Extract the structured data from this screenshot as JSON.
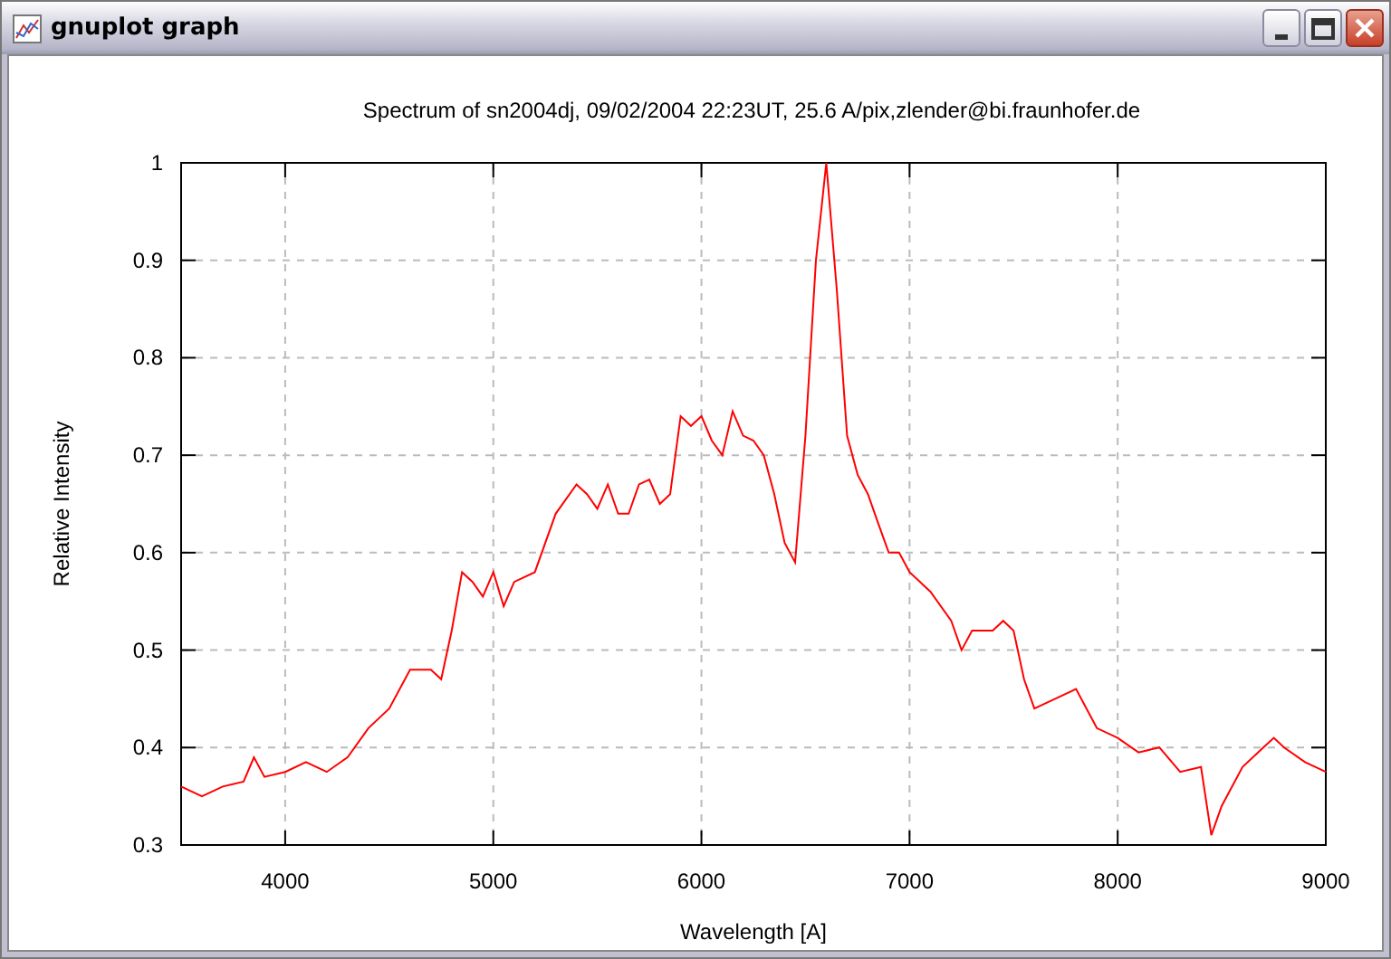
{
  "window": {
    "title": "gnuplot graph"
  },
  "chart_data": {
    "type": "line",
    "title": "Spectrum of sn2004dj, 09/02/2004 22:23UT, 25.6 A/pix,zlender@bi.fraunhofer.de",
    "xlabel": "Wavelength [A]",
    "ylabel": "Relative Intensity",
    "x": [
      3500,
      3600,
      3700,
      3800,
      3850,
      3900,
      4000,
      4100,
      4200,
      4300,
      4400,
      4500,
      4600,
      4700,
      4750,
      4800,
      4850,
      4900,
      4950,
      5000,
      5050,
      5100,
      5200,
      5300,
      5400,
      5450,
      5500,
      5550,
      5600,
      5650,
      5700,
      5750,
      5800,
      5850,
      5900,
      5950,
      6000,
      6050,
      6100,
      6150,
      6200,
      6250,
      6300,
      6350,
      6400,
      6450,
      6500,
      6550,
      6600,
      6650,
      6700,
      6750,
      6800,
      6850,
      6900,
      6950,
      7000,
      7100,
      7200,
      7250,
      7300,
      7400,
      7450,
      7500,
      7550,
      7600,
      7700,
      7800,
      7900,
      8000,
      8100,
      8200,
      8300,
      8400,
      8450,
      8500,
      8600,
      8700,
      8750,
      8800,
      8900,
      9000
    ],
    "grid": true,
    "series": [
      {
        "color": "#ff0000",
        "values": [
          0.36,
          0.35,
          0.36,
          0.365,
          0.39,
          0.37,
          0.375,
          0.385,
          0.375,
          0.39,
          0.42,
          0.44,
          0.48,
          0.48,
          0.47,
          0.52,
          0.58,
          0.57,
          0.555,
          0.58,
          0.545,
          0.57,
          0.58,
          0.64,
          0.67,
          0.66,
          0.645,
          0.67,
          0.64,
          0.64,
          0.67,
          0.675,
          0.65,
          0.66,
          0.74,
          0.73,
          0.74,
          0.715,
          0.7,
          0.745,
          0.72,
          0.715,
          0.7,
          0.66,
          0.61,
          0.59,
          0.72,
          0.9,
          1.0,
          0.87,
          0.72,
          0.68,
          0.66,
          0.63,
          0.6,
          0.6,
          0.58,
          0.56,
          0.53,
          0.5,
          0.52,
          0.52,
          0.53,
          0.52,
          0.47,
          0.44,
          0.45,
          0.46,
          0.42,
          0.41,
          0.395,
          0.4,
          0.375,
          0.38,
          0.31,
          0.34,
          0.38,
          0.4,
          0.41,
          0.4,
          0.385,
          0.375
        ]
      }
    ],
    "xlim": [
      3500,
      9000
    ],
    "ylim": [
      0.3,
      1
    ],
    "xticks": [
      4000,
      5000,
      6000,
      7000,
      8000,
      9000
    ],
    "yticks": [
      0.3,
      0.4,
      0.5,
      0.6,
      0.7,
      0.8,
      0.9,
      1
    ]
  }
}
